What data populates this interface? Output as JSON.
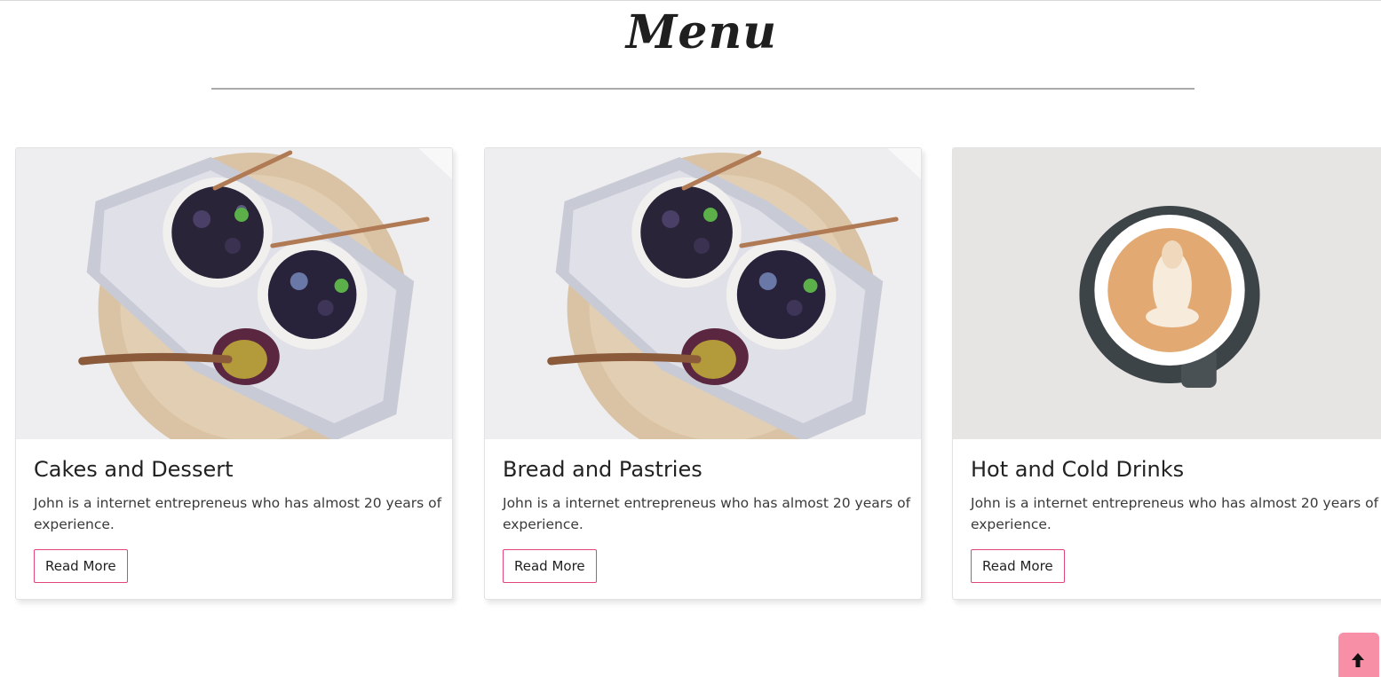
{
  "section": {
    "title": "Menu"
  },
  "cards": [
    {
      "title": "Cakes and Dessert",
      "description": "John is a internet entrepreneus who has almost 20 years of experience.",
      "button_label": "Read More",
      "image": "berry-parfait-bowls-photo"
    },
    {
      "title": "Bread and Pastries",
      "description": "John is a internet entrepreneus who has almost 20 years of experience.",
      "button_label": "Read More",
      "image": "berry-parfait-bowls-photo"
    },
    {
      "title": "Hot and Cold Drinks",
      "description": "John is a internet entrepreneus who has almost 20 years of experience.",
      "button_label": "Read More",
      "image": "latte-art-coffee-cup-photo"
    }
  ],
  "scroll_top": {
    "icon": "arrow-up-icon"
  },
  "colors": {
    "accent_border": "#e0457b",
    "scroll_top_bg": "#f78fa7",
    "divider": "#a9a9a9"
  }
}
